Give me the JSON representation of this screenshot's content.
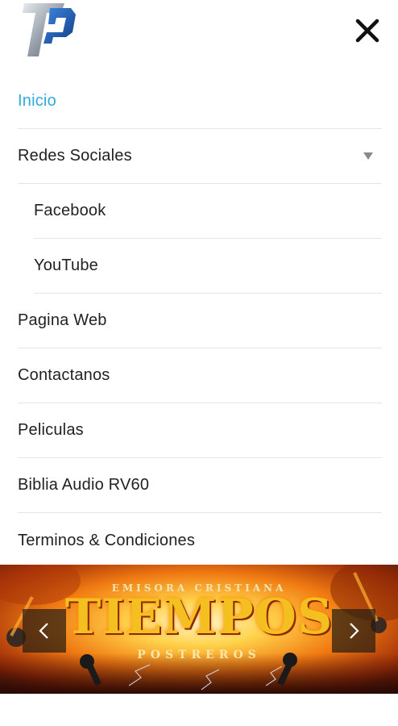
{
  "app": {
    "logo_icon": "tp-logo",
    "close_icon": "close-icon"
  },
  "menu": {
    "items": [
      {
        "label": "Inicio",
        "active": true
      },
      {
        "label": "Redes Sociales",
        "expandable": true,
        "caret_icon": "caret-down-icon"
      },
      {
        "label": "Facebook",
        "sub": true
      },
      {
        "label": "YouTube",
        "sub": true
      },
      {
        "label": "Pagina Web"
      },
      {
        "label": "Contactanos"
      },
      {
        "label": "Peliculas"
      },
      {
        "label": "Biblia Audio RV60"
      },
      {
        "label": "Terminos & Condiciones"
      }
    ]
  },
  "banner": {
    "subtitle": "EMISORA CRISTIANA",
    "title": "TIEMPOS",
    "footer": "POSTREROS",
    "prev_icon": "chevron-left-icon",
    "next_icon": "chevron-right-icon"
  },
  "colors": {
    "active": "#2eaadc",
    "divider": "#e6e6e6",
    "logo_blue": "#1f5fb8",
    "logo_silver": "#9aa3ad"
  }
}
